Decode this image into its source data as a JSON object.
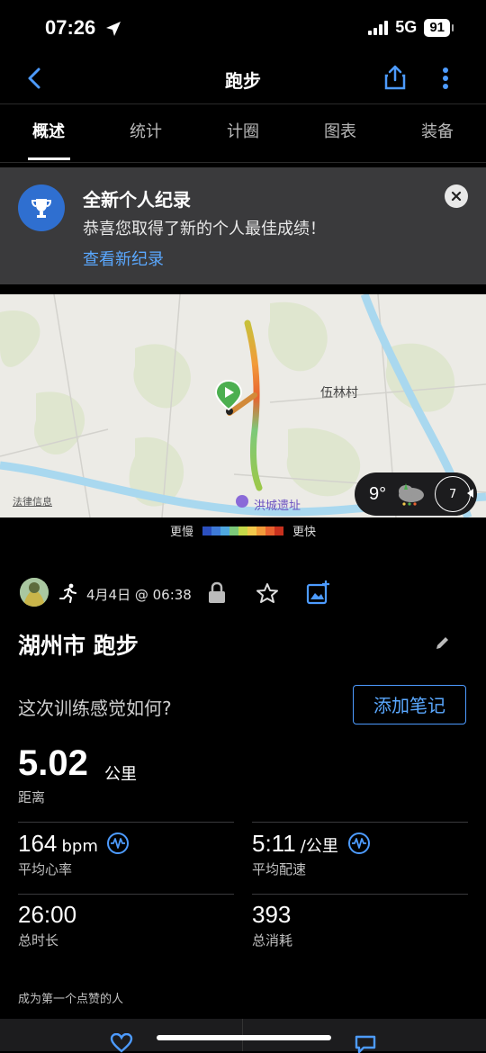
{
  "status": {
    "time": "07:26",
    "network": "5G",
    "battery": "91"
  },
  "header": {
    "title": "跑步"
  },
  "tabs": [
    "概述",
    "统计",
    "计圈",
    "图表",
    "装备"
  ],
  "banner": {
    "title": "全新个人纪录",
    "text": "恭喜您取得了新的个人最佳成绩！",
    "link": "查看新纪录"
  },
  "map": {
    "place1": "伍林村",
    "place2": "洪城遗址",
    "legal": "法律信息",
    "temp": "9°",
    "wind": "7"
  },
  "legend": {
    "slow": "更慢",
    "fast": "更快",
    "colors": [
      "#2b4fbf",
      "#3e7ad8",
      "#4fa8e0",
      "#7cc97a",
      "#c5d94a",
      "#f2c94c",
      "#f29b3a",
      "#e8622f",
      "#c8311e"
    ]
  },
  "activity": {
    "date": "4月4日 @ 06:38",
    "title": "湖州市 跑步",
    "feel_prompt": "这次训练感觉如何?",
    "add_note": "添加笔记"
  },
  "distance": {
    "value": "5.02",
    "unit": "公里",
    "label": "距离"
  },
  "stats": {
    "hr": {
      "value": "164",
      "unit": "bpm",
      "label": "平均心率"
    },
    "pace": {
      "value": "5:11",
      "unit": "/公里",
      "label": "平均配速"
    },
    "time": {
      "value": "26:00",
      "label": "总时长"
    },
    "cal": {
      "value": "393",
      "label": "总消耗"
    }
  },
  "likes_text": "成为第一个点赞的人"
}
